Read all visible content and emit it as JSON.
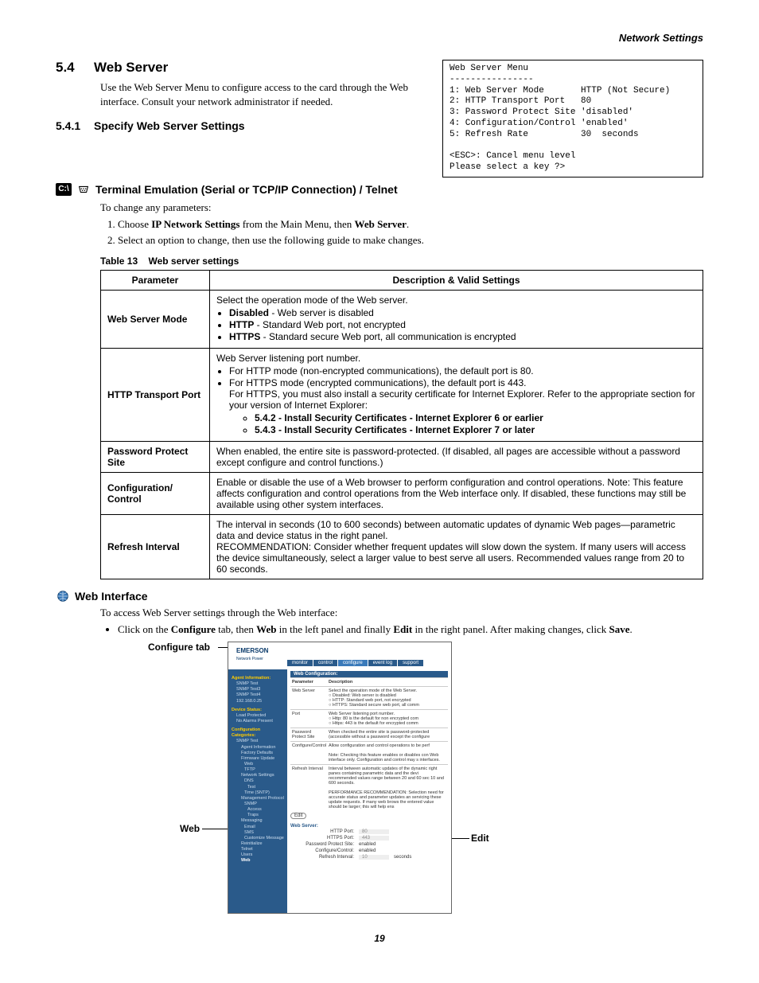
{
  "header": {
    "chapter": "Network Settings"
  },
  "section": {
    "number": "5.4",
    "title": "Web Server",
    "intro": "Use the Web Server Menu to configure access to the card through the Web interface. Consult your network administrator if needed."
  },
  "menu_box": "Web Server Menu\n----------------\n1: Web Server Mode       HTTP (Not Secure)\n2: HTTP Transport Port   80\n3: Password Protect Site 'disabled'\n4: Configuration/Control 'enabled'\n5: Refresh Rate          30  seconds\n\n<ESC>: Cancel menu level\nPlease select a key ?>",
  "subsection": {
    "number": "5.4.1",
    "title": "Specify Web Server Settings",
    "terminal_heading": "Terminal Emulation (Serial or TCP/IP Connection) / Telnet",
    "change_intro": "To change any parameters:",
    "steps": {
      "s1_a": "Choose ",
      "s1_b": "IP Network Settings",
      "s1_c": " from the Main Menu, then ",
      "s1_d": "Web Server",
      "s1_e": ".",
      "s2": "Select an option to change, then use the following guide to make changes."
    }
  },
  "table": {
    "caption_a": "Table 13",
    "caption_b": "Web server settings",
    "header_param": "Parameter",
    "header_desc": "Description & Valid Settings",
    "rows": {
      "r1": {
        "param": "Web Server Mode",
        "line1": "Select the operation mode of the Web server.",
        "b1_a": "Disabled",
        "b1_b": " - Web server is disabled",
        "b2_a": "HTTP",
        "b2_b": " - Standard Web port, not encrypted",
        "b3_a": "HTTPS",
        "b3_b": " - Standard secure Web port, all communication is encrypted"
      },
      "r2": {
        "param": "HTTP Transport Port",
        "line1": "Web Server listening port number.",
        "b1": "For HTTP mode (non-encrypted communications), the default port is 80.",
        "b2": "For HTTPS mode (encrypted communications), the default port is 443.",
        "b2b": "For HTTPS, you must also install a security certificate for Internet Explorer. Refer to the appropriate section for your version of Internet Explorer:",
        "i1": "5.4.2 - Install Security Certificates - Internet Explorer 6 or earlier",
        "i2": "5.4.3 - Install Security Certificates - Internet Explorer 7 or later"
      },
      "r3": {
        "param": "Password Protect Site",
        "desc": "When enabled, the entire site is password-protected. (If disabled, all pages are accessible without a password except configure and control functions.)"
      },
      "r4": {
        "param": "Configuration/ Control",
        "desc": "Enable or disable the use of a Web browser to perform configuration and control operations. Note: This feature affects configuration and control operations from the Web interface only. If disabled, these functions may still be available using other system interfaces."
      },
      "r5": {
        "param": "Refresh Interval",
        "desc": "The interval in seconds (10 to 600 seconds) between automatic updates of dynamic Web pages—parametric data and device status in the right panel.\nRECOMMENDATION: Consider whether frequent updates will slow down the system. If many users will access the device simultaneously, select a larger value to best serve all users. Recommended values range from 20 to 60 seconds."
      }
    }
  },
  "web_interface": {
    "title": "Web Interface",
    "intro": "To access Web Server settings through the Web interface:",
    "step_a": "Click on the ",
    "step_b": "Configure",
    "step_c": " tab, then ",
    "step_d": "Web",
    "step_e": " in the left panel and finally ",
    "step_f": "Edit",
    "step_g": " in the right panel. After making changes, click ",
    "step_h": "Save",
    "step_i": "."
  },
  "callouts": {
    "configure_tab": "Configure tab",
    "web": "Web",
    "edit": "Edit"
  },
  "screenshot": {
    "logo": "EMERSON",
    "logo_sub": "Network Power",
    "tabs": {
      "monitor": "monitor",
      "control": "control",
      "configure": "configure",
      "eventlog": "event log",
      "support": "support"
    },
    "main_title": "Web Configuration:",
    "grid_hdr_param": "Parameter",
    "grid_hdr_desc": "Description",
    "grid": {
      "p1": "Web Server",
      "d1": "Select the operation mode of the Web Server.",
      "d1a": "○ Disabled: Web server is disabled",
      "d1b": "○ HTTP: Standard web port, not encrypted",
      "d1c": "○ HTTPS: Standard secure web port, all comm",
      "p2": "Port",
      "d2": "Web Server listening port number.",
      "d2a": "○ Http: 80 is the default for non encrypted com",
      "d2b": "○ Https: 443 is the default for encrypted comm",
      "p3": "Password Protect Site",
      "d3": "When checked the entire site is password-protected (accessible without a password except the configure",
      "p4": "Configure/Control",
      "d4": "Allow configuration and control operations to be perf",
      "d4a": "Note: Checking this feature enables or disables con Web interface only. Configuration and control may s interfaces.",
      "p5": "Refresh Interval",
      "d5": "Interval between automatic updates of the dynamic right panes containing parametric data and the devi recommended values range between 20 and 60 sec 10 and 600 seconds.",
      "d5a": "PERFORMANCE RECOMMENDATION: Selection need for accurate status and parameter updates an servicing these update requests. If many web brows the entered value should be larger; this will help ens"
    },
    "edit_btn": "Edit",
    "form": {
      "title": "Web Server:",
      "http_port_lbl": "HTTP Port:",
      "http_port_val": "80",
      "https_port_lbl": "HTTPS Port:",
      "https_port_val": "443",
      "pps_lbl": "Password Protect Site:",
      "pps_val": "enabled",
      "cc_lbl": "Configure/Control:",
      "cc_val": "enabled",
      "ri_lbl": "Refresh Interval:",
      "ri_val": "10",
      "ri_unit": "seconds"
    },
    "sidebar": {
      "agent_hdr": "Agent Information:",
      "a1": "SNMP Test",
      "a2": "SNMP Test3",
      "a3": "SNMP Test4",
      "a4": "192.168.0.25",
      "status_hdr": "Device Status:",
      "s1": "Load Protected",
      "s2": "No Alarms Present",
      "cat_hdr": "Configuration Categories:",
      "c_snmp": "SNMP Test",
      "c1": "Agent Information",
      "c2": "Factory Defaults",
      "c3": "Firmware Update",
      "c4": "Web",
      "c5": "TFTP",
      "c_net": "Network Settings",
      "c6": "DNS",
      "c7": "Test",
      "c8": "Time (SNTP)",
      "c9": "Management Protocol",
      "c_snmp2": "SNMP",
      "c10": "Access",
      "c11": "Traps",
      "c_msg": "Messaging",
      "c12": "Email",
      "c13": "SMS",
      "c14": "Customize Message",
      "c_re": "Reinitialize",
      "c15": "Telnet",
      "c16": "Users",
      "c17": "Web"
    }
  },
  "page_number": "19"
}
